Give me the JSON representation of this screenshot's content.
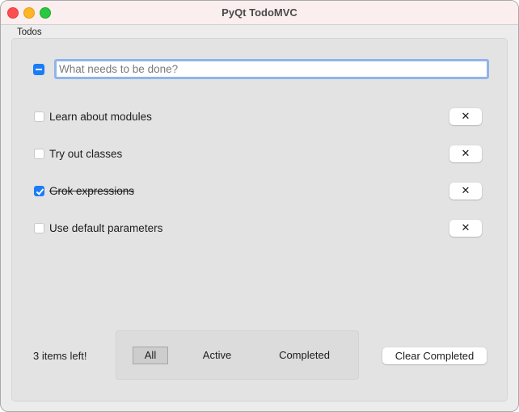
{
  "window": {
    "title": "PyQt TodoMVC"
  },
  "group": {
    "title": "Todos"
  },
  "new_todo": {
    "placeholder": "What needs to be done?",
    "value": ""
  },
  "todos": [
    {
      "label": "Learn about modules",
      "completed": false,
      "delete_label": "✕"
    },
    {
      "label": "Try out classes",
      "completed": false,
      "delete_label": "✕"
    },
    {
      "label": "Grok expressions",
      "completed": true,
      "delete_label": "✕"
    },
    {
      "label": "Use default parameters",
      "completed": false,
      "delete_label": "✕"
    }
  ],
  "footer": {
    "items_left": "3 items left!",
    "filters": [
      {
        "label": "All",
        "active": true
      },
      {
        "label": "Active",
        "active": false
      },
      {
        "label": "Completed",
        "active": false
      }
    ],
    "clear_completed": "Clear Completed"
  }
}
